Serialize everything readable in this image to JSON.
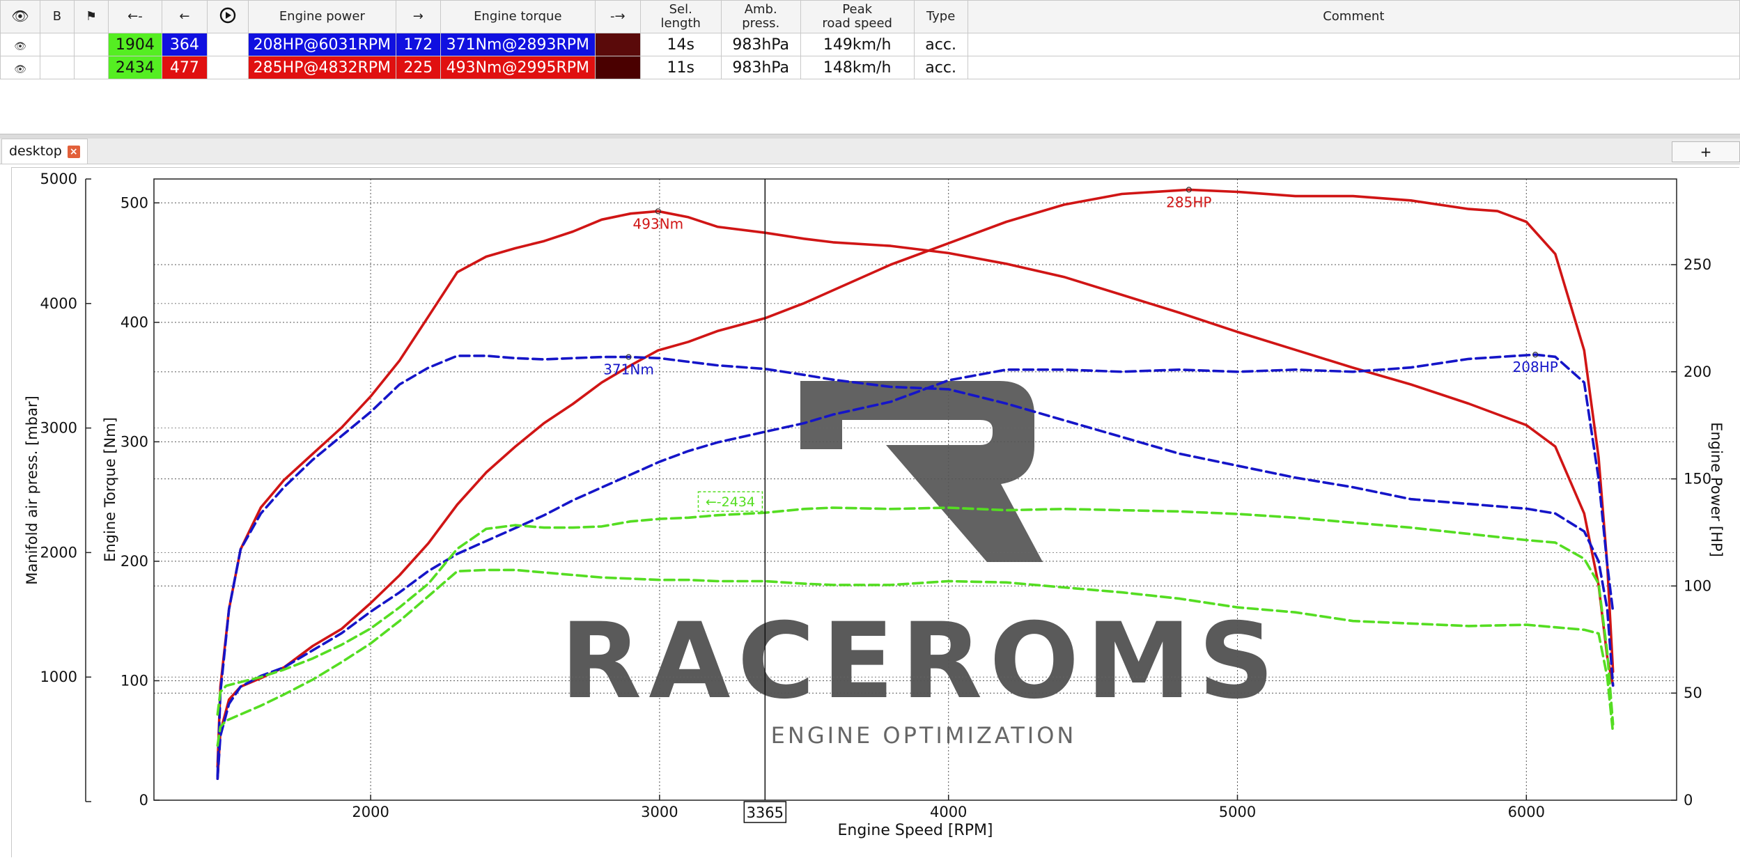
{
  "table": {
    "headers": {
      "visible": "eye-icon",
      "b": "B",
      "flag": "flag-icon",
      "first_arrow": "←-",
      "prev": "←",
      "play": "play-icon",
      "engine_power": "Engine power",
      "arrow_right": "→",
      "engine_torque": "Engine torque",
      "last_arrow": "-→",
      "sel_length_1": "Sel.",
      "sel_length_2": "length",
      "amb_press_1": "Amb.",
      "amb_press_2": "press.",
      "peak_speed_1": "Peak",
      "peak_speed_2": "road speed",
      "type": "Type",
      "comment": "Comment"
    },
    "rows": [
      {
        "run_id": "1904",
        "run_color": "#55ee22",
        "val": "364",
        "val_color": "#1010e0",
        "power": "208HP@6031RPM",
        "power_color": "#1010e0",
        "arrow_val": "172",
        "torque": "371Nm@2893RPM",
        "torque_color": "#1010e0",
        "swatch": "#5a0a0a",
        "sel_length": "14s",
        "amb_press": "983hPa",
        "peak_speed": "149km/h",
        "type": "acc.",
        "comment": ""
      },
      {
        "run_id": "2434",
        "run_color": "#55ee22",
        "val": "477",
        "val_color": "#e01010",
        "power": "285HP@4832RPM",
        "power_color": "#e01010",
        "arrow_val": "225",
        "torque": "493Nm@2995RPM",
        "torque_color": "#e01010",
        "swatch": "#4a0000",
        "sel_length": "11s",
        "amb_press": "983hPa",
        "peak_speed": "148km/h",
        "type": "acc.",
        "comment": ""
      }
    ]
  },
  "tabs": [
    {
      "label": "desktop",
      "close": "×"
    }
  ],
  "add_button": "+",
  "watermark": {
    "brand": "RACEROMS",
    "tagline": "ENGINE OPTIMIZATION"
  },
  "chart_data": {
    "type": "line",
    "xlabel": "Engine Speed [RPM]",
    "ylabel_torque": "Engine Torque [Nm]",
    "ylabel_manifold": "Manifold air press. [mbar]",
    "ylabel_power": "Engine Power [HP]",
    "xlim": [
      1250,
      6520
    ],
    "ylim_torque": [
      0,
      520
    ],
    "ylim_power": [
      0,
      290
    ],
    "ylim_manifold": [
      0,
      5000
    ],
    "xticks": [
      2000,
      3000,
      4000,
      5000,
      6000
    ],
    "yticks_torque": [
      0,
      100,
      200,
      300,
      400,
      500
    ],
    "yticks_power": [
      0,
      50,
      100,
      150,
      200,
      250
    ],
    "yticks_manifold": [
      1000,
      2000,
      3000,
      4000,
      5000
    ],
    "grid": true,
    "cursor_x": 3365,
    "cursor_label": "3365",
    "series_label": "←-2434",
    "series_label_color": "#55dd22",
    "series_label_pos": {
      "x": 3240,
      "y": 250
    },
    "annotations": [
      {
        "text": "493Nm",
        "x": 2995,
        "y": 493,
        "axis": "torque",
        "color": "#d01515"
      },
      {
        "text": "285HP",
        "x": 4832,
        "y": 285,
        "axis": "power",
        "color": "#d01515"
      },
      {
        "text": "371Nm",
        "x": 2893,
        "y": 371,
        "axis": "torque",
        "color": "#1515c8"
      },
      {
        "text": "208HP",
        "x": 6031,
        "y": 208,
        "axis": "power",
        "color": "#1515c8"
      }
    ],
    "series": [
      {
        "axis": "torque",
        "color": "#d01515",
        "dash": false,
        "points": [
          [
            1470,
            28
          ],
          [
            1480,
            95
          ],
          [
            1510,
            160
          ],
          [
            1550,
            210
          ],
          [
            1620,
            245
          ],
          [
            1700,
            268
          ],
          [
            1800,
            290
          ],
          [
            1900,
            312
          ],
          [
            2000,
            338
          ],
          [
            2100,
            368
          ],
          [
            2200,
            405
          ],
          [
            2300,
            442
          ],
          [
            2400,
            455
          ],
          [
            2500,
            462
          ],
          [
            2600,
            468
          ],
          [
            2700,
            476
          ],
          [
            2800,
            486
          ],
          [
            2900,
            491
          ],
          [
            2995,
            493
          ],
          [
            3100,
            488
          ],
          [
            3200,
            480
          ],
          [
            3365,
            475
          ],
          [
            3500,
            470
          ],
          [
            3600,
            467
          ],
          [
            3800,
            464
          ],
          [
            4000,
            458
          ],
          [
            4200,
            449
          ],
          [
            4400,
            438
          ],
          [
            4600,
            423
          ],
          [
            4800,
            408
          ],
          [
            5000,
            392
          ],
          [
            5200,
            377
          ],
          [
            5400,
            362
          ],
          [
            5600,
            348
          ],
          [
            5800,
            332
          ],
          [
            6000,
            314
          ],
          [
            6100,
            296
          ],
          [
            6200,
            240
          ],
          [
            6250,
            180
          ],
          [
            6280,
            120
          ],
          [
            6300,
            96
          ]
        ]
      },
      {
        "axis": "power",
        "color": "#d01515",
        "dash": false,
        "points": [
          [
            1470,
            10
          ],
          [
            1480,
            32
          ],
          [
            1510,
            47
          ],
          [
            1550,
            53
          ],
          [
            1620,
            57
          ],
          [
            1700,
            62
          ],
          [
            1800,
            72
          ],
          [
            1900,
            80
          ],
          [
            2000,
            92
          ],
          [
            2100,
            105
          ],
          [
            2200,
            120
          ],
          [
            2300,
            138
          ],
          [
            2400,
            153
          ],
          [
            2500,
            165
          ],
          [
            2600,
            176
          ],
          [
            2700,
            185
          ],
          [
            2800,
            195
          ],
          [
            2900,
            203
          ],
          [
            2995,
            210
          ],
          [
            3100,
            214
          ],
          [
            3200,
            219
          ],
          [
            3365,
            225
          ],
          [
            3500,
            232
          ],
          [
            3600,
            238
          ],
          [
            3800,
            250
          ],
          [
            4000,
            260
          ],
          [
            4200,
            270
          ],
          [
            4400,
            278
          ],
          [
            4600,
            283
          ],
          [
            4832,
            285
          ],
          [
            5000,
            284
          ],
          [
            5200,
            282
          ],
          [
            5400,
            282
          ],
          [
            5600,
            280
          ],
          [
            5800,
            276
          ],
          [
            5900,
            275
          ],
          [
            6000,
            270
          ],
          [
            6100,
            255
          ],
          [
            6200,
            210
          ],
          [
            6250,
            160
          ],
          [
            6280,
            110
          ],
          [
            6300,
            60
          ]
        ]
      },
      {
        "axis": "torque",
        "color": "#1515c8",
        "dash": true,
        "points": [
          [
            1470,
            20
          ],
          [
            1480,
            90
          ],
          [
            1510,
            160
          ],
          [
            1550,
            210
          ],
          [
            1620,
            240
          ],
          [
            1700,
            262
          ],
          [
            1800,
            285
          ],
          [
            1900,
            305
          ],
          [
            2000,
            325
          ],
          [
            2100,
            348
          ],
          [
            2200,
            362
          ],
          [
            2300,
            372
          ],
          [
            2400,
            372
          ],
          [
            2500,
            370
          ],
          [
            2600,
            369
          ],
          [
            2700,
            370
          ],
          [
            2800,
            371
          ],
          [
            2893,
            371
          ],
          [
            3000,
            370
          ],
          [
            3100,
            367
          ],
          [
            3200,
            364
          ],
          [
            3365,
            361
          ],
          [
            3500,
            356
          ],
          [
            3600,
            352
          ],
          [
            3800,
            346
          ],
          [
            4000,
            344
          ],
          [
            4200,
            332
          ],
          [
            4400,
            318
          ],
          [
            4600,
            304
          ],
          [
            4800,
            290
          ],
          [
            5000,
            280
          ],
          [
            5200,
            270
          ],
          [
            5400,
            262
          ],
          [
            5600,
            252
          ],
          [
            5800,
            248
          ],
          [
            6000,
            244
          ],
          [
            6100,
            240
          ],
          [
            6200,
            225
          ],
          [
            6250,
            200
          ],
          [
            6280,
            160
          ],
          [
            6300,
            96
          ]
        ]
      },
      {
        "axis": "power",
        "color": "#1515c8",
        "dash": true,
        "points": [
          [
            1470,
            10
          ],
          [
            1480,
            30
          ],
          [
            1510,
            45
          ],
          [
            1550,
            53
          ],
          [
            1620,
            58
          ],
          [
            1700,
            62
          ],
          [
            1800,
            70
          ],
          [
            1900,
            78
          ],
          [
            2000,
            88
          ],
          [
            2100,
            97
          ],
          [
            2200,
            107
          ],
          [
            2300,
            115
          ],
          [
            2400,
            121
          ],
          [
            2500,
            127
          ],
          [
            2600,
            133
          ],
          [
            2700,
            140
          ],
          [
            2800,
            146
          ],
          [
            2900,
            152
          ],
          [
            3000,
            158
          ],
          [
            3100,
            163
          ],
          [
            3200,
            167
          ],
          [
            3365,
            172
          ],
          [
            3500,
            176
          ],
          [
            3600,
            180
          ],
          [
            3800,
            186
          ],
          [
            4000,
            196
          ],
          [
            4200,
            201
          ],
          [
            4400,
            201
          ],
          [
            4600,
            200
          ],
          [
            4800,
            201
          ],
          [
            5000,
            200
          ],
          [
            5200,
            201
          ],
          [
            5400,
            200
          ],
          [
            5600,
            202
          ],
          [
            5800,
            206
          ],
          [
            6031,
            208
          ],
          [
            6100,
            207
          ],
          [
            6200,
            195
          ],
          [
            6250,
            150
          ],
          [
            6280,
            110
          ],
          [
            6300,
            88
          ]
        ]
      },
      {
        "axis": "manifold",
        "color": "#55dd22",
        "dash": true,
        "points": [
          [
            1470,
            700
          ],
          [
            1480,
            880
          ],
          [
            1500,
            930
          ],
          [
            1550,
            960
          ],
          [
            1620,
            1000
          ],
          [
            1700,
            1060
          ],
          [
            1800,
            1150
          ],
          [
            1900,
            1260
          ],
          [
            2000,
            1390
          ],
          [
            2100,
            1560
          ],
          [
            2200,
            1750
          ],
          [
            2300,
            2030
          ],
          [
            2400,
            2190
          ],
          [
            2500,
            2220
          ],
          [
            2600,
            2200
          ],
          [
            2700,
            2200
          ],
          [
            2800,
            2210
          ],
          [
            2900,
            2250
          ],
          [
            3000,
            2270
          ],
          [
            3100,
            2280
          ],
          [
            3200,
            2300
          ],
          [
            3365,
            2320
          ],
          [
            3500,
            2350
          ],
          [
            3600,
            2360
          ],
          [
            3800,
            2350
          ],
          [
            4000,
            2360
          ],
          [
            4200,
            2340
          ],
          [
            4400,
            2350
          ],
          [
            4600,
            2340
          ],
          [
            4800,
            2330
          ],
          [
            5000,
            2310
          ],
          [
            5200,
            2280
          ],
          [
            5400,
            2240
          ],
          [
            5600,
            2200
          ],
          [
            5800,
            2150
          ],
          [
            6000,
            2100
          ],
          [
            6100,
            2080
          ],
          [
            6200,
            1950
          ],
          [
            6250,
            1750
          ],
          [
            6280,
            1200
          ],
          [
            6300,
            620
          ]
        ]
      },
      {
        "axis": "manifold",
        "color": "#55dd22",
        "dash": true,
        "points": [
          [
            1470,
            450
          ],
          [
            1480,
            600
          ],
          [
            1500,
            650
          ],
          [
            1550,
            700
          ],
          [
            1620,
            770
          ],
          [
            1700,
            860
          ],
          [
            1800,
            980
          ],
          [
            1900,
            1120
          ],
          [
            2000,
            1270
          ],
          [
            2100,
            1450
          ],
          [
            2200,
            1650
          ],
          [
            2300,
            1850
          ],
          [
            2400,
            1860
          ],
          [
            2500,
            1860
          ],
          [
            2600,
            1840
          ],
          [
            2700,
            1820
          ],
          [
            2800,
            1800
          ],
          [
            2900,
            1790
          ],
          [
            3000,
            1780
          ],
          [
            3100,
            1780
          ],
          [
            3200,
            1770
          ],
          [
            3365,
            1770
          ],
          [
            3500,
            1750
          ],
          [
            3600,
            1740
          ],
          [
            3800,
            1740
          ],
          [
            4000,
            1770
          ],
          [
            4200,
            1760
          ],
          [
            4400,
            1720
          ],
          [
            4600,
            1680
          ],
          [
            4800,
            1630
          ],
          [
            5000,
            1560
          ],
          [
            5200,
            1520
          ],
          [
            5400,
            1450
          ],
          [
            5600,
            1430
          ],
          [
            5800,
            1410
          ],
          [
            6000,
            1420
          ],
          [
            6100,
            1400
          ],
          [
            6200,
            1380
          ],
          [
            6250,
            1350
          ],
          [
            6280,
            1000
          ],
          [
            6300,
            550
          ]
        ]
      }
    ]
  }
}
